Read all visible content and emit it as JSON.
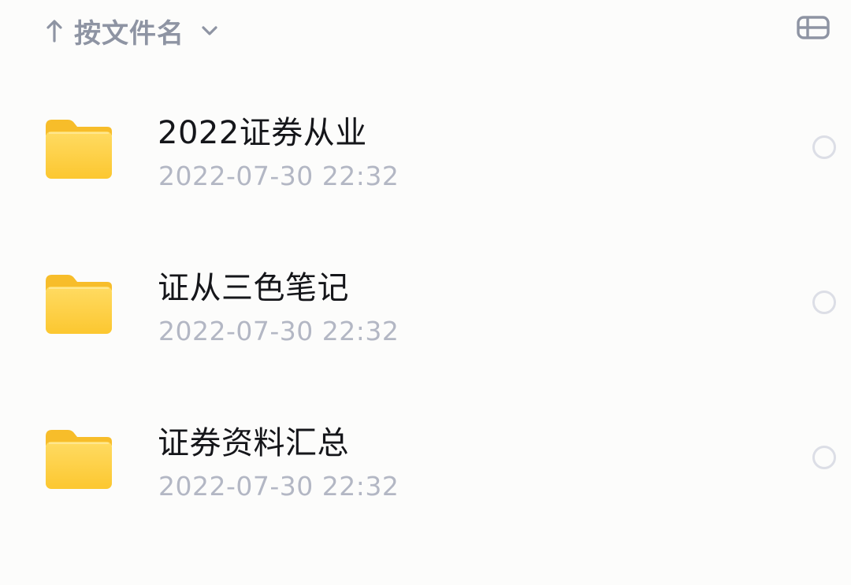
{
  "sort": {
    "arrow_icon": "arrow-up-icon",
    "label": "按文件名",
    "chevron_icon": "chevron-down-icon"
  },
  "view_toggle": {
    "icon": "list-view-icon"
  },
  "files": [
    {
      "name": "2022证券从业",
      "date": "2022-07-30 22:32",
      "icon": "folder-icon"
    },
    {
      "name": "证从三色笔记",
      "date": "2022-07-30 22:32",
      "icon": "folder-icon"
    },
    {
      "name": "证券资料汇总",
      "date": "2022-07-30 22:32",
      "icon": "folder-icon"
    }
  ],
  "colors": {
    "background": "#fcfcfb",
    "folder_top": "#ffd95a",
    "folder_bottom": "#fcc93a",
    "name_text": "#15161a",
    "secondary_text": "#b3b7c4",
    "header_text": "#8e94a3"
  }
}
